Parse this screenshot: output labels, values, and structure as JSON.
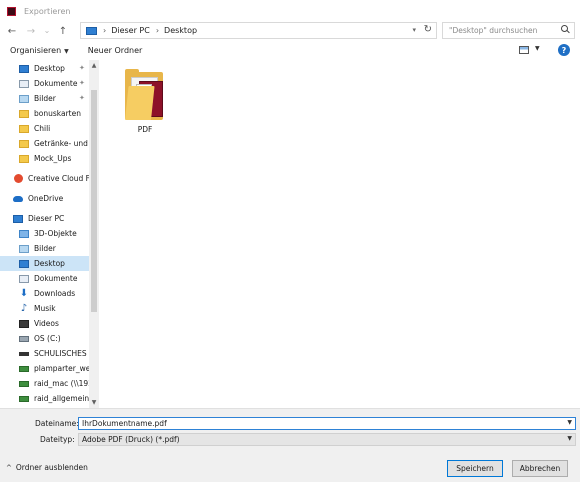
{
  "window": {
    "title": "Exportieren"
  },
  "nav": {
    "back": "←",
    "forward": "→",
    "recent": "⌄",
    "up": "↑",
    "breadcrumb": [
      "Dieser PC",
      "Desktop"
    ],
    "refresh": "↻",
    "search_placeholder": "\"Desktop\" durchsuchen"
  },
  "toolbar": {
    "organize": "Organisieren",
    "new_folder": "Neuer Ordner",
    "help": "?"
  },
  "sidebar": {
    "items": [
      {
        "label": "Desktop",
        "icon": "desktop-icon",
        "pinned": true
      },
      {
        "label": "Dokumente",
        "icon": "documents-icon",
        "pinned": true
      },
      {
        "label": "Bilder",
        "icon": "pictures-icon",
        "pinned": true
      },
      {
        "label": "bonuskarten",
        "icon": "folder-icon"
      },
      {
        "label": "Chili",
        "icon": "folder-icon"
      },
      {
        "label": "Getränke- und S",
        "icon": "folder-icon"
      },
      {
        "label": "Mock_Ups",
        "icon": "folder-icon"
      },
      {
        "label": "Creative Cloud Fil",
        "icon": "creative-cloud-icon"
      },
      {
        "label": "OneDrive",
        "icon": "onedrive-icon"
      },
      {
        "label": "Dieser PC",
        "icon": "this-pc-icon"
      },
      {
        "label": "3D-Objekte",
        "icon": "3d-objects-icon"
      },
      {
        "label": "Bilder",
        "icon": "pictures-icon"
      },
      {
        "label": "Desktop",
        "icon": "desktop-icon",
        "selected": true
      },
      {
        "label": "Dokumente",
        "icon": "documents-icon"
      },
      {
        "label": "Downloads",
        "icon": "downloads-icon"
      },
      {
        "label": "Musik",
        "icon": "music-icon"
      },
      {
        "label": "Videos",
        "icon": "videos-icon"
      },
      {
        "label": "OS (C:)",
        "icon": "drive-icon"
      },
      {
        "label": "SCHULISCHES (D",
        "icon": "usb-drive-icon"
      },
      {
        "label": "plamparter_web",
        "icon": "network-drive-icon"
      },
      {
        "label": "raid_mac (\\\\192.",
        "icon": "network-drive-icon"
      },
      {
        "label": "raid_allgemein (",
        "icon": "network-drive-icon"
      }
    ]
  },
  "content": {
    "files": [
      {
        "name": "PDF",
        "icon": "pdf-folder-icon"
      }
    ]
  },
  "form": {
    "filename_label": "Dateiname:",
    "filename_value": "IhrDokumentname.pdf",
    "filetype_label": "Dateityp:",
    "filetype_value": "Adobe PDF (Druck) (*.pdf)"
  },
  "footer": {
    "hide_folders": "Ordner ausblenden",
    "save": "Speichern",
    "cancel": "Abbrechen"
  }
}
